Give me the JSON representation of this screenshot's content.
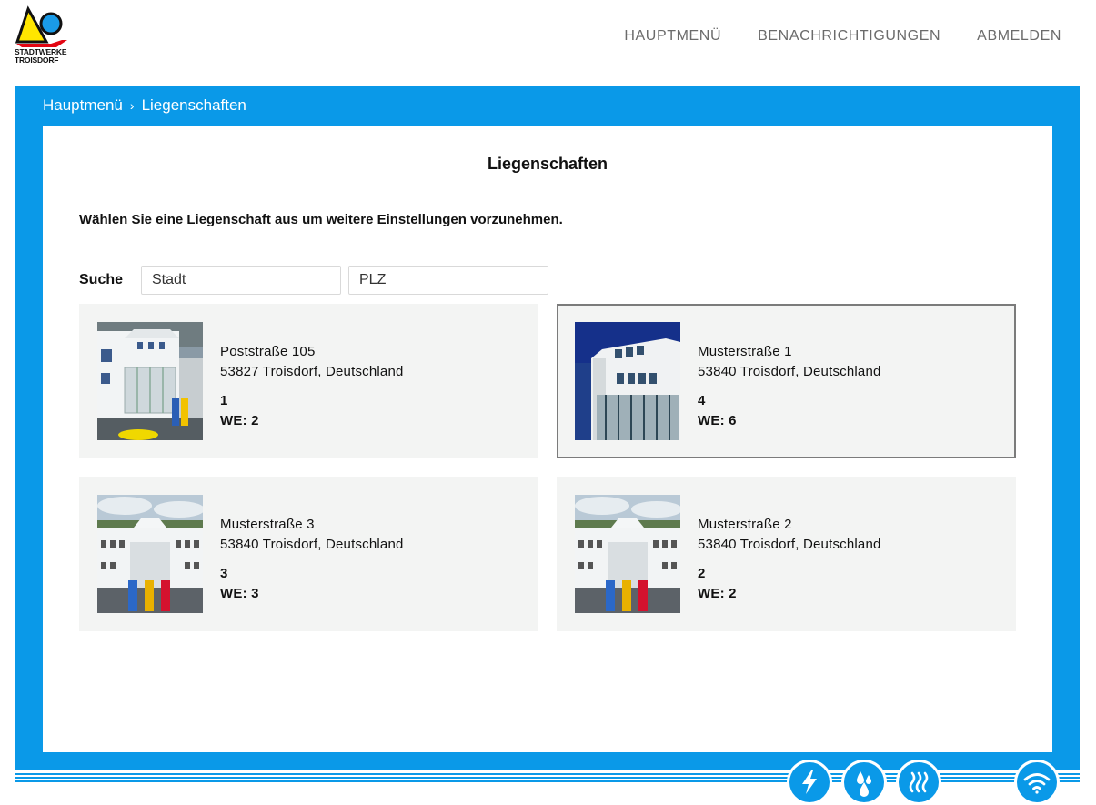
{
  "brand": {
    "line1": "STADTWERKE",
    "line2": "TROISDORF"
  },
  "nav": {
    "main": "HAUPTMENÜ",
    "notifications": "BENACHRICHTIGUNGEN",
    "logout": "ABMELDEN"
  },
  "breadcrumb": {
    "home": "Hauptmenü",
    "separator": "›",
    "current": "Liegenschaften"
  },
  "page": {
    "title": "Liegenschaften",
    "instruction": "Wählen Sie eine Liegenschaft aus um weitere Einstellungen vorzunehmen."
  },
  "search": {
    "label": "Suche",
    "city_placeholder": "Stadt",
    "zip_placeholder": "PLZ"
  },
  "properties": [
    {
      "street": "Poststraße 105",
      "city": "53827 Troisdorf, Deutschland",
      "number": "1",
      "units": "WE: 2",
      "selected": false
    },
    {
      "street": "Musterstraße 1",
      "city": "53840 Troisdorf, Deutschland",
      "number": "4",
      "units": "WE: 6",
      "selected": true
    },
    {
      "street": "Musterstraße 3",
      "city": "53840 Troisdorf, Deutschland",
      "number": "3",
      "units": "WE: 3",
      "selected": false
    },
    {
      "street": "Musterstraße 2",
      "city": "53840 Troisdorf, Deutschland",
      "number": "2",
      "units": "WE: 2",
      "selected": false
    }
  ],
  "bottom_icons": [
    "lightning-icon",
    "water-drops-icon",
    "heat-icon",
    "wifi-icon"
  ],
  "colors": {
    "accent": "#0a99e8",
    "card_bg": "#f3f4f3",
    "nav_text": "#6b6b6b",
    "selected_border": "#7b7b7b"
  }
}
